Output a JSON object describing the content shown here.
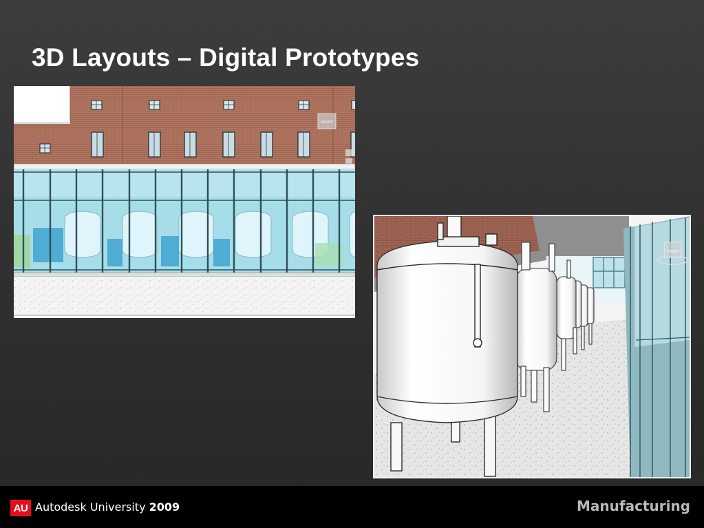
{
  "slide": {
    "title": "3D Layouts – Digital Prototypes"
  },
  "render1": {
    "view_cube_label": "RIGHT"
  },
  "render2": {
    "view_cube_label": "FRONT"
  },
  "footer": {
    "brand_name": "Autodesk University",
    "brand_year": "2009",
    "logo_text": "AU",
    "logo_color": "#e3101a",
    "track_label": "Manufacturing"
  }
}
